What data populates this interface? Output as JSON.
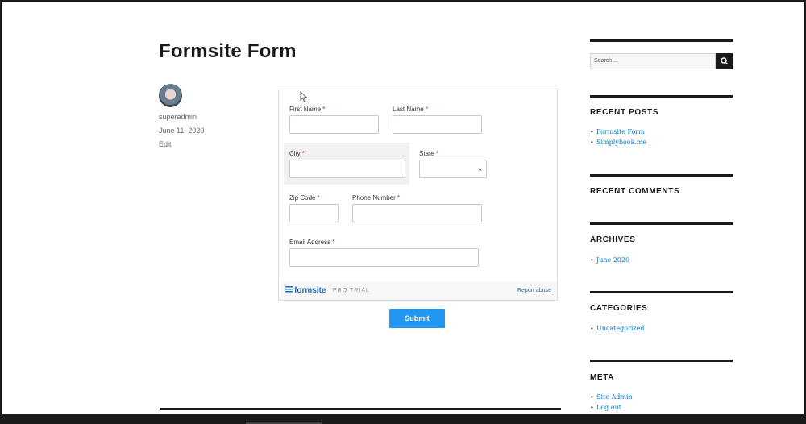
{
  "post": {
    "title": "Formsite Form",
    "author": "superadmin",
    "date": "June 11, 2020",
    "edit_label": "Edit"
  },
  "form": {
    "first_name_label": "First Name",
    "last_name_label": "Last Name",
    "city_label": "City",
    "state_label": "State",
    "zip_label": "Zip Code",
    "phone_label": "Phone Number",
    "email_label": "Email Address",
    "required_marker": "*",
    "select_chevron": "⌄",
    "footer_logo": "formsite",
    "footer_pro": "PRO TRIAL",
    "footer_report": "Report abuse"
  },
  "submit_label": "Submit",
  "sidebar": {
    "search_placeholder": "Search ...",
    "recent_posts_heading": "RECENT POSTS",
    "recent_posts": [
      "Formsite Form",
      "Simplybook.me"
    ],
    "recent_comments_heading": "RECENT COMMENTS",
    "archives_heading": "ARCHIVES",
    "archives": [
      "June 2020"
    ],
    "categories_heading": "CATEGORIES",
    "categories": [
      "Uncategorized"
    ],
    "meta_heading": "META",
    "meta_links": [
      "Site Admin",
      "Log out"
    ]
  },
  "colors": {
    "accent": "#2196f3",
    "link": "#007acc",
    "required": "#cc2222",
    "text": "#1a1a1a"
  },
  "icons": [
    "search-icon",
    "mouse-pointer-icon",
    "chevron-down-icon",
    "formsite-logo-icon"
  ]
}
